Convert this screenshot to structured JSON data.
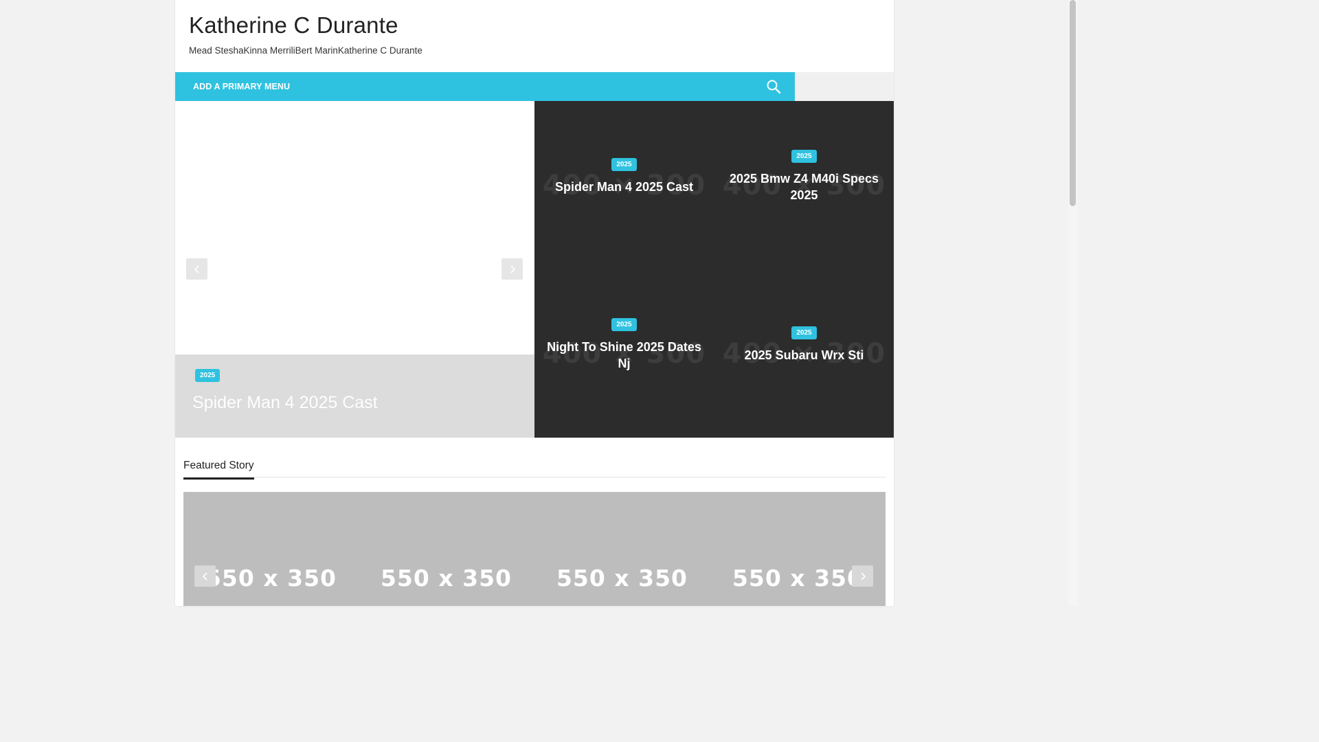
{
  "site": {
    "title": "Katherine C Durante",
    "description": "Mead SteshaKinna MerriliBert MarinKatherine C Durante"
  },
  "nav": {
    "primary_menu_label": "ADD A PRIMARY MENU",
    "search_icon": "search-icon"
  },
  "slider": {
    "badge": "2025",
    "title": "Spider Man 4 2025 Cast",
    "prev_icon": "chevron-left-icon",
    "next_icon": "chevron-right-icon"
  },
  "grid": {
    "placeholder": "400 × 300",
    "items": [
      {
        "badge": "2025",
        "title": "Spider Man 4 2025 Cast"
      },
      {
        "badge": "2025",
        "title": "2025 Bmw Z4 M40i Specs 2025"
      },
      {
        "badge": "2025",
        "title": "Night To Shine 2025 Dates Nj"
      },
      {
        "badge": "2025",
        "title": "2025 Subaru Wrx Sti"
      }
    ]
  },
  "featured": {
    "heading": "Featured Story",
    "placeholder": "550 x 350"
  },
  "colors": {
    "accent": "#2fc2e0",
    "dark_panel": "#2c2c2c"
  }
}
